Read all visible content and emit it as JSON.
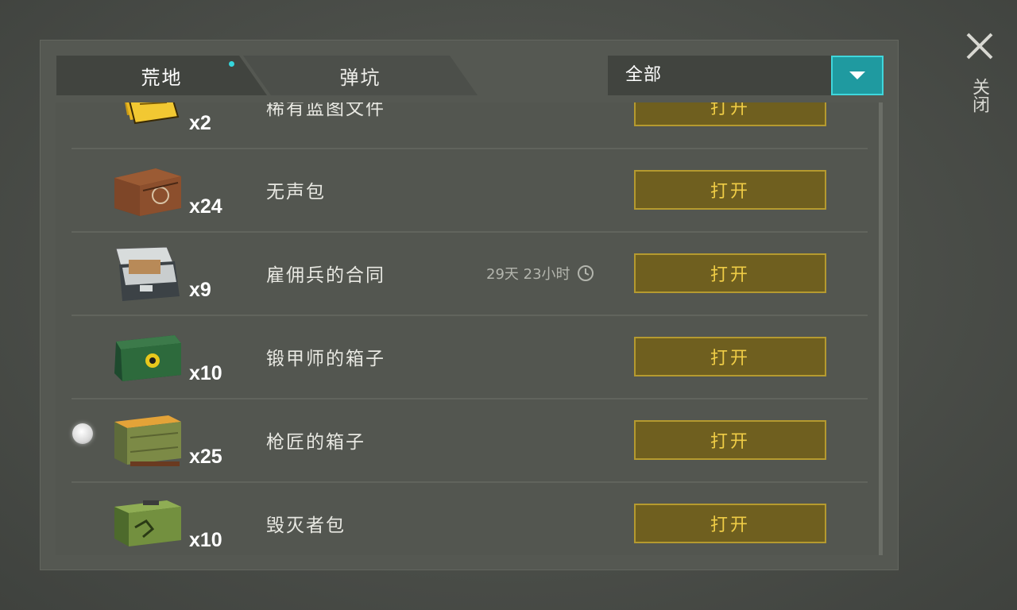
{
  "tabs": [
    {
      "label": "荒地",
      "active": true,
      "has_notification": true
    },
    {
      "label": "弹坑",
      "active": false
    }
  ],
  "filter": {
    "selected": "全部",
    "accent_color": "#1f9aa0"
  },
  "close": {
    "label": "关闭"
  },
  "items": [
    {
      "name": "稀有蓝图文件",
      "count": "x2",
      "icon": "yellow-folder-icon",
      "action": "打开"
    },
    {
      "name": "无声包",
      "count": "x24",
      "icon": "wooden-crate-icon",
      "action": "打开"
    },
    {
      "name": "雇佣兵的合同",
      "count": "x9",
      "icon": "metal-case-icon",
      "action": "打开",
      "timer": "29天 23小时"
    },
    {
      "name": "锻甲师的箱子",
      "count": "x10",
      "icon": "green-biohazard-chest-icon",
      "action": "打开"
    },
    {
      "name": "枪匠的箱子",
      "count": "x25",
      "icon": "orange-crate-icon",
      "action": "打开",
      "selected": true
    },
    {
      "name": "毁灭者包",
      "count": "x10",
      "icon": "green-weapon-crate-icon",
      "action": "打开"
    }
  ],
  "colors": {
    "button_bg": "#6f5f1f",
    "button_border": "#b59a2f",
    "button_text": "#f0cd46",
    "notification_dot": "#35d6dc"
  }
}
